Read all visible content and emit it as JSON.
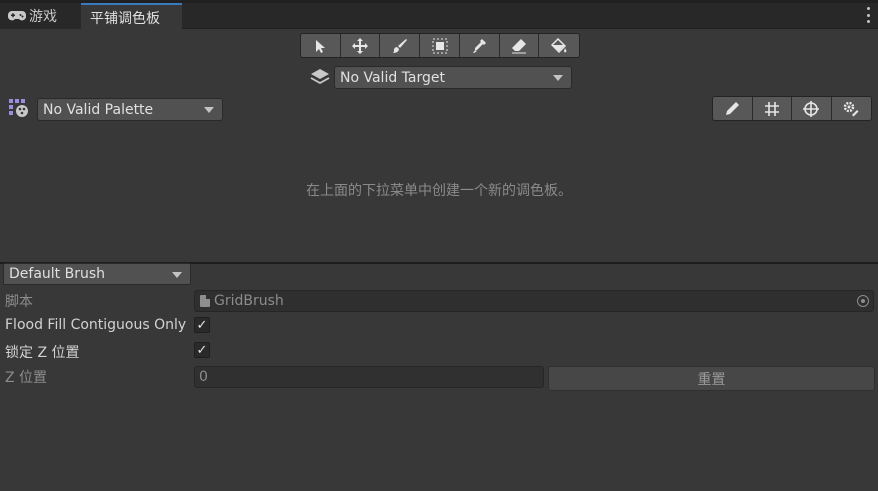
{
  "tabs": [
    {
      "label": "游戏",
      "icon": "gamepad-icon"
    },
    {
      "label": "平铺调色板"
    }
  ],
  "toolbar": {
    "tools": [
      "select-tool-icon",
      "move-tool-icon",
      "paint-brush-icon",
      "box-fill-icon",
      "picker-icon",
      "eraser-icon",
      "fill-bucket-icon"
    ]
  },
  "target": {
    "icon": "layers-icon",
    "value": "No Valid Target"
  },
  "palette": {
    "icon": "palette-icon",
    "value": "No Valid Palette",
    "tools": [
      "edit-pencil-icon",
      "grid-icon",
      "gizmo-icon",
      "settings-icon"
    ]
  },
  "empty_message": "在上面的下拉菜单中创建一个新的调色板。",
  "inspector": {
    "brush": "Default Brush",
    "script_label": "脚本",
    "script_value": "GridBrush",
    "flood_label": "Flood Fill Contiguous Only",
    "flood_checked": true,
    "lockz_label": "锁定 Z 位置",
    "lockz_checked": true,
    "zpos_label": "Z 位置",
    "zpos_value": "0",
    "reset_label": "重置"
  },
  "colors": {
    "accent": "#3a79bb",
    "background": "#383838",
    "tabbar": "#282828"
  }
}
